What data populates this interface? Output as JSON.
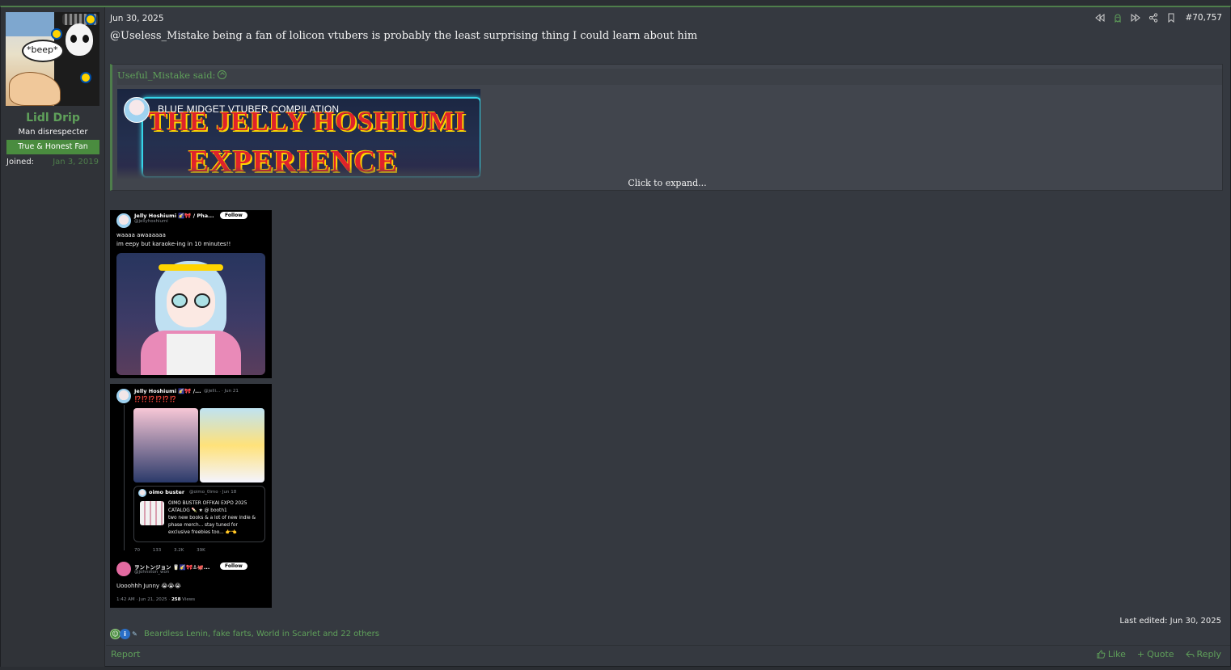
{
  "user": {
    "avatar_caption": "*beep*",
    "name": "Lidl Drip",
    "title": "Man disrespecter",
    "banner": "True & Honest Fan",
    "joined_label": "Joined:",
    "joined_value": "Jan 3, 2019"
  },
  "post": {
    "date": "Jun 30, 2025",
    "number": "#70,757",
    "text": "@Useless_Mistake being a fan of lolicon vtubers is probably the least surprising thing I could learn about him",
    "header_icons": [
      "rewind-icon",
      "ghost-icon",
      "fast-forward-icon",
      "share-icon",
      "bookmark-icon"
    ]
  },
  "quote": {
    "author_said": "Useful_Mistake said:",
    "embed": {
      "video_title": "BLUE MIDGET VTUBER COMPILATION",
      "thumbnail_line1": "THE JELLY HOSHIUMI",
      "thumbnail_line2": "EXPERIENCE"
    },
    "expand": "Click to expand..."
  },
  "attachments": {
    "tweet1": {
      "name": "Jelly Hoshiumi 🌠🎀 / Pha...",
      "handle": "@jellyhoshiumi",
      "follow": "Follow",
      "line1": "waaaa awaaaaaa",
      "line2": "im eepy but karaoke-ing in 10 minutes!!"
    },
    "tweet2": {
      "name": "Jelly Hoshiumi 🌠🎀 /...",
      "handle": "@jelli... · Jun 21",
      "exclaim": "⁉️⁉️⁉️⁉️⁉️⁉️",
      "quoted_name": "oimo buster",
      "quoted_handle": "@oimo_0imo · Jun 18",
      "quoted_l1": "OIMO BUSTER OFFKAI EXPO 2025",
      "quoted_l2": "CATALOG 🍡 ★ @ booth1",
      "quoted_l3": "two new books & a lot of new indie &",
      "quoted_l4": "phase merch... stay tuned for",
      "quoted_l5": "exclusive freebies too... 👉👈",
      "stats": "70 133 3.2K 39K",
      "reply_name": "ヲントンジョン 🥛🌠🎀⚓🐙...",
      "reply_handle": "@johnston_won",
      "reply_follow": "Follow",
      "reply_text": "Uooohhh Junny 😭😭😭",
      "meta_time": "1:42 AM · Jun 21, 2025 · ",
      "meta_views": "258",
      "meta_views_label": " Views"
    }
  },
  "last_edited": "Last edited: Jun 30, 2025",
  "reactions": {
    "icons": [
      "laugh-reaction-icon",
      "informative-reaction-icon",
      "pen-reaction-icon"
    ],
    "list": "Beardless Lenin, fake farts, World in Scarlet and 22 others"
  },
  "footer": {
    "report": "Report",
    "like": "Like",
    "quote": "Quote",
    "reply": "Reply"
  },
  "colors": {
    "accent": "#5fa05a",
    "banner": "#4a8c3f",
    "background": "#353940"
  }
}
